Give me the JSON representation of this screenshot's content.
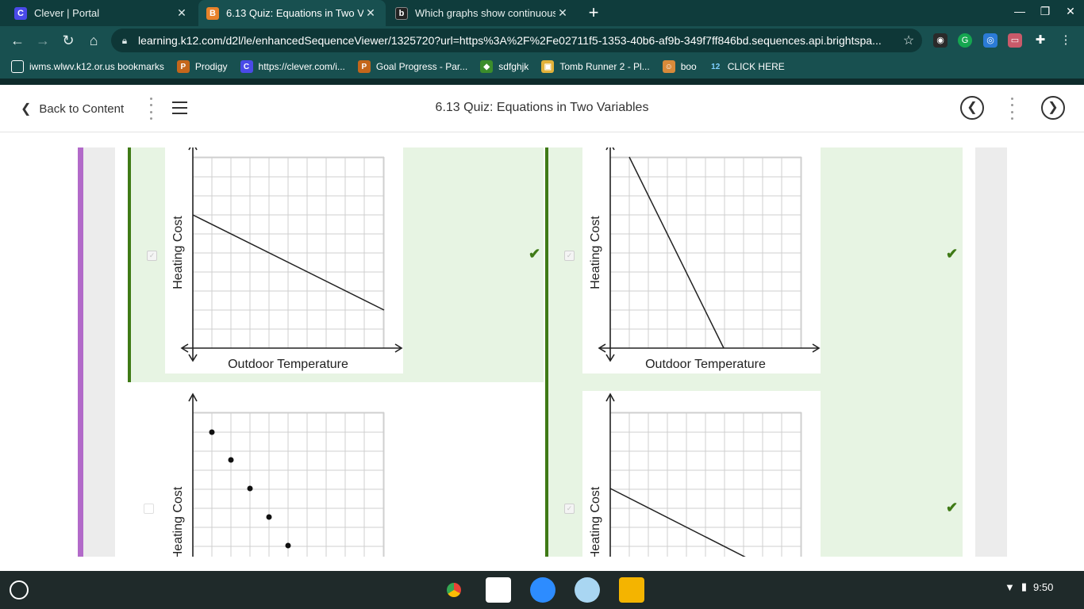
{
  "browser": {
    "tabs": [
      {
        "title": "Clever | Portal",
        "icon": "C",
        "icon_color": "#4a4ae8"
      },
      {
        "title": "6.13 Quiz: Equations in Two Variables",
        "icon": "B",
        "icon_color": "#e8822a"
      },
      {
        "title": "Which graphs show continuous",
        "icon": "b",
        "icon_color": "#222222"
      }
    ],
    "url": "learning.k12.com/d2l/le/enhancedSequenceViewer/1325720?url=https%3A%2F%2Fe02711f5-1353-40b6-af9b-349f7ff846bd.sequences.api.brightspa...",
    "bookmarks": [
      {
        "label": "iwms.wlwv.k12.or.us bookmarks",
        "icon": "folder-icon"
      },
      {
        "label": "Prodigy",
        "icon": "prodigy-icon"
      },
      {
        "label": "https://clever.com/i...",
        "icon": "clever-icon"
      },
      {
        "label": "Goal Progress - Par...",
        "icon": "prodigy-icon"
      },
      {
        "label": "sdfghjk",
        "icon": "game-icon"
      },
      {
        "label": "Tomb Runner 2 - Pl...",
        "icon": "game-icon"
      },
      {
        "label": "boo",
        "icon": "avatar-icon"
      },
      {
        "label": "CLICK HERE",
        "icon": "12-icon"
      }
    ]
  },
  "quiz": {
    "back_label": "Back to Content",
    "title": "6.13 Quiz: Equations in Two Variables"
  },
  "graphs": {
    "ylabel": "Heating Cost",
    "xlabel": "Outdoor Temperature"
  },
  "options": [
    {
      "id": "A",
      "selected": true,
      "correct": true,
      "kind": "line",
      "description": "decreasing line, gentle slope"
    },
    {
      "id": "B",
      "selected": true,
      "correct": true,
      "kind": "line",
      "description": "decreasing line, steep slope"
    },
    {
      "id": "C",
      "selected": false,
      "correct": false,
      "kind": "points",
      "description": "discrete decreasing points"
    },
    {
      "id": "D",
      "selected": true,
      "correct": true,
      "kind": "line",
      "description": "decreasing line"
    }
  ],
  "colors": {
    "accent": "#b26ac9",
    "correct_bg": "#e7f4e3",
    "correct_mark": "#3f7a16"
  },
  "shelf": {
    "time": "9:50"
  }
}
